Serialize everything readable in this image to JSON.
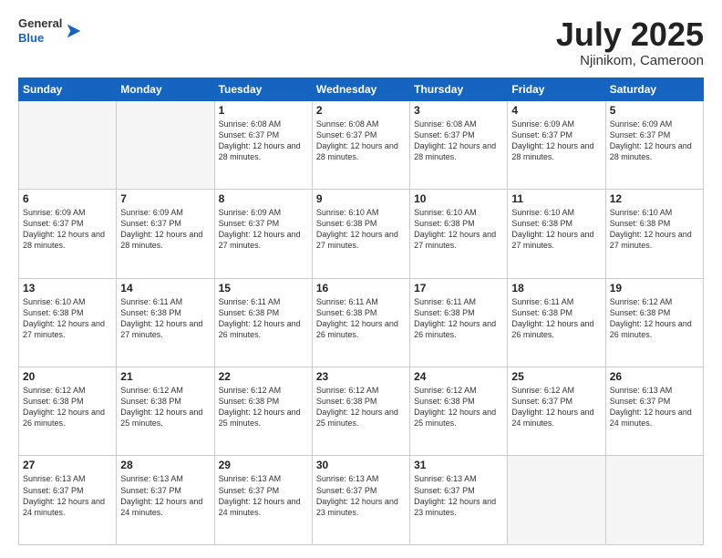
{
  "header": {
    "logo": {
      "general": "General",
      "blue": "Blue"
    },
    "title": "July 2025",
    "subtitle": "Njinikom, Cameroon"
  },
  "weekdays": [
    "Sunday",
    "Monday",
    "Tuesday",
    "Wednesday",
    "Thursday",
    "Friday",
    "Saturday"
  ],
  "weeks": [
    [
      {
        "day": "",
        "info": ""
      },
      {
        "day": "",
        "info": ""
      },
      {
        "day": "1",
        "sunrise": "Sunrise: 6:08 AM",
        "sunset": "Sunset: 6:37 PM",
        "daylight": "Daylight: 12 hours and 28 minutes."
      },
      {
        "day": "2",
        "sunrise": "Sunrise: 6:08 AM",
        "sunset": "Sunset: 6:37 PM",
        "daylight": "Daylight: 12 hours and 28 minutes."
      },
      {
        "day": "3",
        "sunrise": "Sunrise: 6:08 AM",
        "sunset": "Sunset: 6:37 PM",
        "daylight": "Daylight: 12 hours and 28 minutes."
      },
      {
        "day": "4",
        "sunrise": "Sunrise: 6:09 AM",
        "sunset": "Sunset: 6:37 PM",
        "daylight": "Daylight: 12 hours and 28 minutes."
      },
      {
        "day": "5",
        "sunrise": "Sunrise: 6:09 AM",
        "sunset": "Sunset: 6:37 PM",
        "daylight": "Daylight: 12 hours and 28 minutes."
      }
    ],
    [
      {
        "day": "6",
        "sunrise": "Sunrise: 6:09 AM",
        "sunset": "Sunset: 6:37 PM",
        "daylight": "Daylight: 12 hours and 28 minutes."
      },
      {
        "day": "7",
        "sunrise": "Sunrise: 6:09 AM",
        "sunset": "Sunset: 6:37 PM",
        "daylight": "Daylight: 12 hours and 28 minutes."
      },
      {
        "day": "8",
        "sunrise": "Sunrise: 6:09 AM",
        "sunset": "Sunset: 6:37 PM",
        "daylight": "Daylight: 12 hours and 27 minutes."
      },
      {
        "day": "9",
        "sunrise": "Sunrise: 6:10 AM",
        "sunset": "Sunset: 6:38 PM",
        "daylight": "Daylight: 12 hours and 27 minutes."
      },
      {
        "day": "10",
        "sunrise": "Sunrise: 6:10 AM",
        "sunset": "Sunset: 6:38 PM",
        "daylight": "Daylight: 12 hours and 27 minutes."
      },
      {
        "day": "11",
        "sunrise": "Sunrise: 6:10 AM",
        "sunset": "Sunset: 6:38 PM",
        "daylight": "Daylight: 12 hours and 27 minutes."
      },
      {
        "day": "12",
        "sunrise": "Sunrise: 6:10 AM",
        "sunset": "Sunset: 6:38 PM",
        "daylight": "Daylight: 12 hours and 27 minutes."
      }
    ],
    [
      {
        "day": "13",
        "sunrise": "Sunrise: 6:10 AM",
        "sunset": "Sunset: 6:38 PM",
        "daylight": "Daylight: 12 hours and 27 minutes."
      },
      {
        "day": "14",
        "sunrise": "Sunrise: 6:11 AM",
        "sunset": "Sunset: 6:38 PM",
        "daylight": "Daylight: 12 hours and 27 minutes."
      },
      {
        "day": "15",
        "sunrise": "Sunrise: 6:11 AM",
        "sunset": "Sunset: 6:38 PM",
        "daylight": "Daylight: 12 hours and 26 minutes."
      },
      {
        "day": "16",
        "sunrise": "Sunrise: 6:11 AM",
        "sunset": "Sunset: 6:38 PM",
        "daylight": "Daylight: 12 hours and 26 minutes."
      },
      {
        "day": "17",
        "sunrise": "Sunrise: 6:11 AM",
        "sunset": "Sunset: 6:38 PM",
        "daylight": "Daylight: 12 hours and 26 minutes."
      },
      {
        "day": "18",
        "sunrise": "Sunrise: 6:11 AM",
        "sunset": "Sunset: 6:38 PM",
        "daylight": "Daylight: 12 hours and 26 minutes."
      },
      {
        "day": "19",
        "sunrise": "Sunrise: 6:12 AM",
        "sunset": "Sunset: 6:38 PM",
        "daylight": "Daylight: 12 hours and 26 minutes."
      }
    ],
    [
      {
        "day": "20",
        "sunrise": "Sunrise: 6:12 AM",
        "sunset": "Sunset: 6:38 PM",
        "daylight": "Daylight: 12 hours and 26 minutes."
      },
      {
        "day": "21",
        "sunrise": "Sunrise: 6:12 AM",
        "sunset": "Sunset: 6:38 PM",
        "daylight": "Daylight: 12 hours and 25 minutes."
      },
      {
        "day": "22",
        "sunrise": "Sunrise: 6:12 AM",
        "sunset": "Sunset: 6:38 PM",
        "daylight": "Daylight: 12 hours and 25 minutes."
      },
      {
        "day": "23",
        "sunrise": "Sunrise: 6:12 AM",
        "sunset": "Sunset: 6:38 PM",
        "daylight": "Daylight: 12 hours and 25 minutes."
      },
      {
        "day": "24",
        "sunrise": "Sunrise: 6:12 AM",
        "sunset": "Sunset: 6:38 PM",
        "daylight": "Daylight: 12 hours and 25 minutes."
      },
      {
        "day": "25",
        "sunrise": "Sunrise: 6:12 AM",
        "sunset": "Sunset: 6:37 PM",
        "daylight": "Daylight: 12 hours and 24 minutes."
      },
      {
        "day": "26",
        "sunrise": "Sunrise: 6:13 AM",
        "sunset": "Sunset: 6:37 PM",
        "daylight": "Daylight: 12 hours and 24 minutes."
      }
    ],
    [
      {
        "day": "27",
        "sunrise": "Sunrise: 6:13 AM",
        "sunset": "Sunset: 6:37 PM",
        "daylight": "Daylight: 12 hours and 24 minutes."
      },
      {
        "day": "28",
        "sunrise": "Sunrise: 6:13 AM",
        "sunset": "Sunset: 6:37 PM",
        "daylight": "Daylight: 12 hours and 24 minutes."
      },
      {
        "day": "29",
        "sunrise": "Sunrise: 6:13 AM",
        "sunset": "Sunset: 6:37 PM",
        "daylight": "Daylight: 12 hours and 24 minutes."
      },
      {
        "day": "30",
        "sunrise": "Sunrise: 6:13 AM",
        "sunset": "Sunset: 6:37 PM",
        "daylight": "Daylight: 12 hours and 23 minutes."
      },
      {
        "day": "31",
        "sunrise": "Sunrise: 6:13 AM",
        "sunset": "Sunset: 6:37 PM",
        "daylight": "Daylight: 12 hours and 23 minutes."
      },
      {
        "day": "",
        "info": ""
      },
      {
        "day": "",
        "info": ""
      }
    ]
  ]
}
